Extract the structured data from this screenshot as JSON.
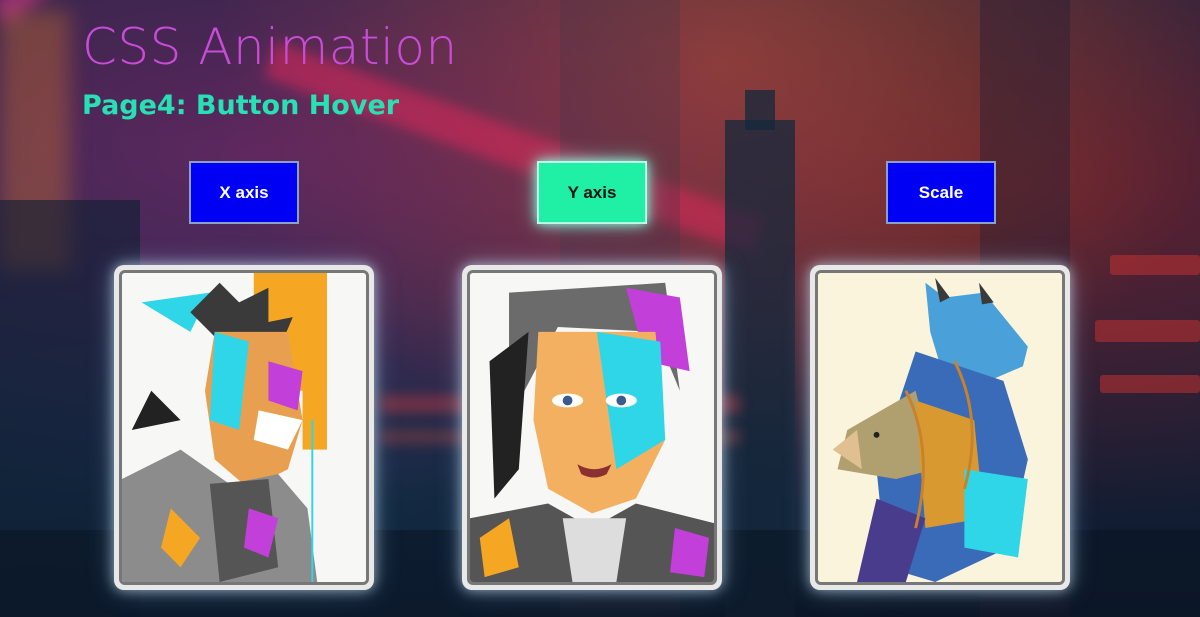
{
  "header": {
    "title": "CSS Animation",
    "subtitle": "Page4: Button Hover"
  },
  "buttons": [
    {
      "label": "X axis",
      "state": "default",
      "color": "#0000f5"
    },
    {
      "label": "Y axis",
      "state": "hover",
      "color": "#1ff0a6"
    },
    {
      "label": "Scale",
      "state": "default",
      "color": "#0000f5"
    }
  ],
  "cards": [
    {
      "subject": "man-portrait-illustration"
    },
    {
      "subject": "woman-portrait-illustration"
    },
    {
      "subject": "bear-animal-illustration"
    }
  ],
  "colors": {
    "title": "#c84cd6",
    "subtitle": "#27e0b4",
    "accent_cyan": "#2fd6e8",
    "accent_orange": "#f5a623",
    "accent_magenta": "#c23fd9"
  }
}
